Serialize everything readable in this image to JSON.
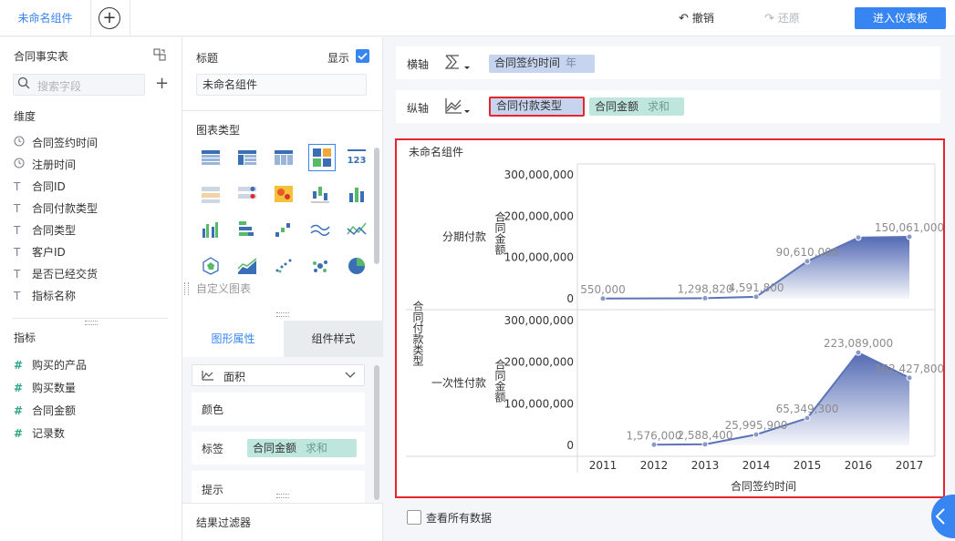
{
  "topbar": {
    "active_tab": "未命名组件",
    "undo_label": "撤销",
    "redo_label": "还原",
    "enter_dashboard_label": "进入仪表板"
  },
  "fields": {
    "table_name": "合同事实表",
    "search_placeholder": "搜索字段",
    "dimensions_title": "维度",
    "dimensions": [
      {
        "label": "合同签约时间",
        "icon": "clock-icon"
      },
      {
        "label": "注册时间",
        "icon": "clock-icon"
      },
      {
        "label": "合同ID",
        "icon": "text-type-icon"
      },
      {
        "label": "合同付款类型",
        "icon": "text-type-icon"
      },
      {
        "label": "合同类型",
        "icon": "text-type-icon"
      },
      {
        "label": "客户ID",
        "icon": "text-type-icon"
      },
      {
        "label": "是否已经交货",
        "icon": "text-type-icon"
      },
      {
        "label": "指标名称",
        "icon": "text-type-icon"
      }
    ],
    "measures_title": "指标",
    "measures": [
      {
        "label": "购买的产品",
        "icon": "hash-icon"
      },
      {
        "label": "购买数量",
        "icon": "hash-icon"
      },
      {
        "label": "合同金额",
        "icon": "hash-icon"
      },
      {
        "label": "记录数",
        "icon": "hash-icon"
      }
    ]
  },
  "config": {
    "title_label": "标题",
    "show_label": "显示",
    "title_value": "未命名组件",
    "chart_type_label": "图表类型",
    "custom_chart_label": "自定义图表",
    "tab_graphic": "图形属性",
    "tab_style": "组件样式",
    "shape_value": "面积",
    "color_label": "颜色",
    "label_label": "标签",
    "label_tag_field": "合同金额",
    "label_tag_agg": "求和",
    "tooltip_label": "提示",
    "result_filter_label": "结果过滤器"
  },
  "axes": {
    "x_label": "横轴",
    "x_field": "合同签约时间",
    "x_field_sub": "年",
    "y_label": "纵轴",
    "y_field1": "合同付款类型",
    "y_field2": "合同金额",
    "y_field2_sub": "求和"
  },
  "chart_data": {
    "type": "area",
    "title": "未命名组件",
    "xlabel": "合同签约时间",
    "row_dimension_label": "合同付款类型",
    "ylabel": "合同金额",
    "categories": [
      "2011",
      "2012",
      "2013",
      "2014",
      "2015",
      "2016",
      "2017"
    ],
    "ylim": [
      0,
      300000000
    ],
    "yticks": [
      "0",
      "100,000,000",
      "200,000,000",
      "300,000,000"
    ],
    "color": "#5b73b8",
    "panels": [
      {
        "name": "分期付款",
        "points": [
          {
            "x": "2011",
            "y": 550000,
            "label": "550,000"
          },
          {
            "x": "2013",
            "y": 1298820,
            "label": "1,298,820"
          },
          {
            "x": "2014",
            "y": 4591800,
            "label": "4,591,800"
          },
          {
            "x": "2015",
            "y": 90610000,
            "label": "90,610,000"
          },
          {
            "x": "2016",
            "y": 148000000,
            "label": ""
          },
          {
            "x": "2017",
            "y": 150061000,
            "label": "150,061,000"
          }
        ]
      },
      {
        "name": "一次性付款",
        "points": [
          {
            "x": "2012",
            "y": 1576000,
            "label": "1,576,000"
          },
          {
            "x": "2013",
            "y": 2588400,
            "label": "2,588,400"
          },
          {
            "x": "2014",
            "y": 25995900,
            "label": "25,995,900"
          },
          {
            "x": "2015",
            "y": 65349300,
            "label": "65,349,300"
          },
          {
            "x": "2016",
            "y": 223089000,
            "label": "223,089,000"
          },
          {
            "x": "2017",
            "y": 162427800,
            "label": "162,427,800"
          }
        ]
      }
    ]
  },
  "footer": {
    "view_all_label": "查看所有数据"
  }
}
